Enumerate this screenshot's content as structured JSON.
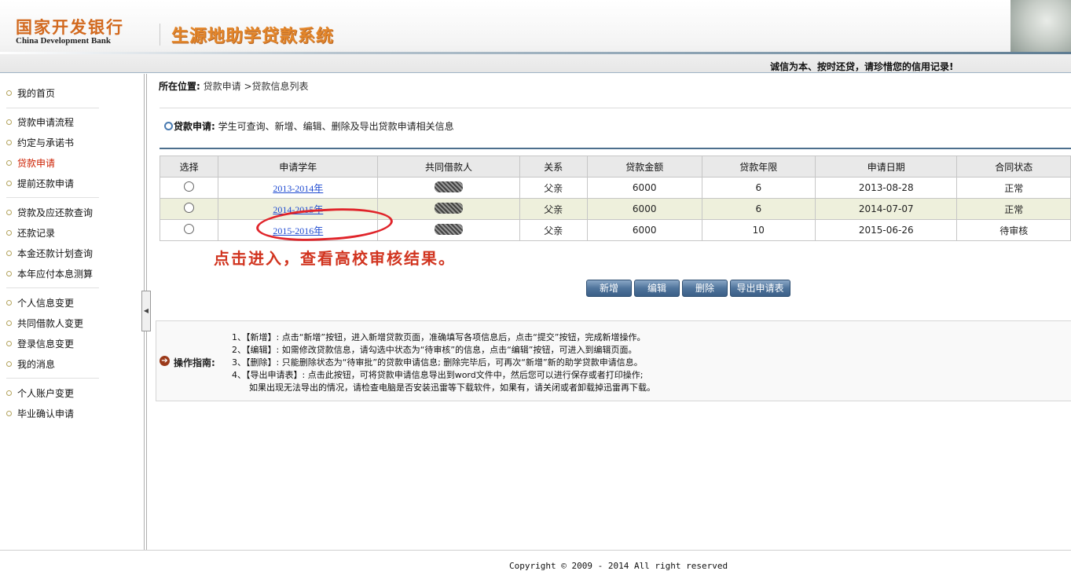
{
  "header": {
    "bank_name_cn": "国家开发银行",
    "bank_name_en": "China Development Bank",
    "system_title": "生源地助学贷款系统",
    "slogan": "诚信为本、按时还贷，请珍惜您的信用记录!"
  },
  "sidebar": {
    "items": [
      {
        "label": "我的首页"
      },
      {
        "label": "贷款申请流程"
      },
      {
        "label": "约定与承诺书"
      },
      {
        "label": "贷款申请",
        "active": true
      },
      {
        "label": "提前还款申请"
      },
      {
        "label": "贷款及应还款查询"
      },
      {
        "label": "还款记录"
      },
      {
        "label": "本金还款计划查询"
      },
      {
        "label": "本年应付本息测算"
      },
      {
        "label": "个人信息变更"
      },
      {
        "label": "共同借款人变更"
      },
      {
        "label": "登录信息变更"
      },
      {
        "label": "我的消息"
      },
      {
        "label": "个人账户变更"
      },
      {
        "label": "毕业确认申请"
      }
    ]
  },
  "breadcrumb": {
    "prefix": "所在位置:",
    "path": "贷款申请 >贷款信息列表"
  },
  "notice": {
    "title": "贷款申请:",
    "text": "学生可查询、新增、编辑、删除及导出贷款申请相关信息"
  },
  "table": {
    "headers": [
      "选择",
      "申请学年",
      "共同借款人",
      "关系",
      "贷款金额",
      "贷款年限",
      "申请日期",
      "合同状态"
    ],
    "rows": [
      {
        "year": "2013-2014年",
        "relation": "父亲",
        "amount": "6000",
        "term": "6",
        "date": "2013-08-28",
        "status": "正常"
      },
      {
        "year": "2014-2015年",
        "relation": "父亲",
        "amount": "6000",
        "term": "6",
        "date": "2014-07-07",
        "status": "正常"
      },
      {
        "year": "2015-2016年",
        "relation": "父亲",
        "amount": "6000",
        "term": "10",
        "date": "2015-06-26",
        "status": "待审核"
      }
    ]
  },
  "annotation": {
    "text": "点击进入，查看高校审核结果。",
    "color": "#d1341f"
  },
  "buttons": {
    "add": "新增",
    "edit": "编辑",
    "delete": "删除",
    "export": "导出申请表"
  },
  "guide": {
    "title": "操作指南:",
    "lines": [
      "1、【新增】: 点击“新增”按钮，进入新增贷款页面，准确填写各项信息后，点击“提交”按钮，完成新增操作。",
      "2、【编辑】: 如需修改贷款信息，请勾选中状态为“待审核”的信息，点击“编辑”按钮，可进入到编辑页面。",
      "3、【删除】: 只能删除状态为“待审批”的贷款申请信息; 删除完毕后，可再次“新增”新的助学贷款申请信息。",
      "4、【导出申请表】: 点击此按钮，可将贷款申请信息导出到word文件中，然后您可以进行保存或者打印操作;",
      "如果出现无法导出的情况，请检查电脑是否安装迅雷等下载软件，如果有，请关闭或者卸载掉迅雷再下载。"
    ]
  },
  "footer": {
    "copyright": "Copyright © 2009 - 2014 All right reserved"
  }
}
